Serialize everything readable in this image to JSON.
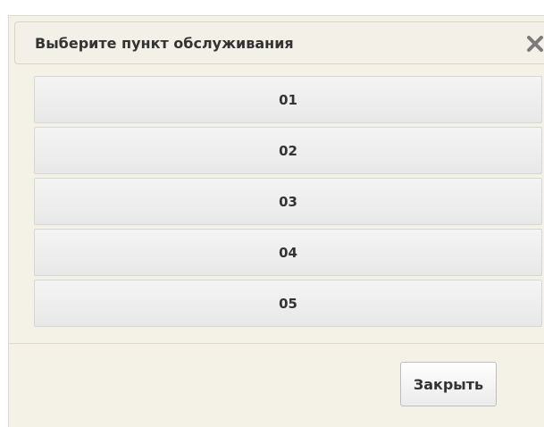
{
  "dialog": {
    "title": "Выберите пункт обслуживания",
    "close_icon": "close-icon",
    "options": [
      {
        "label": "01"
      },
      {
        "label": "02"
      },
      {
        "label": "03"
      },
      {
        "label": "04"
      },
      {
        "label": "05"
      }
    ],
    "close_button_label": "Закрыть"
  },
  "colors": {
    "dialog_background": "#f4f1e7",
    "option_background": "#ececec",
    "text": "#333333",
    "close_icon": "#7a7a7a"
  }
}
